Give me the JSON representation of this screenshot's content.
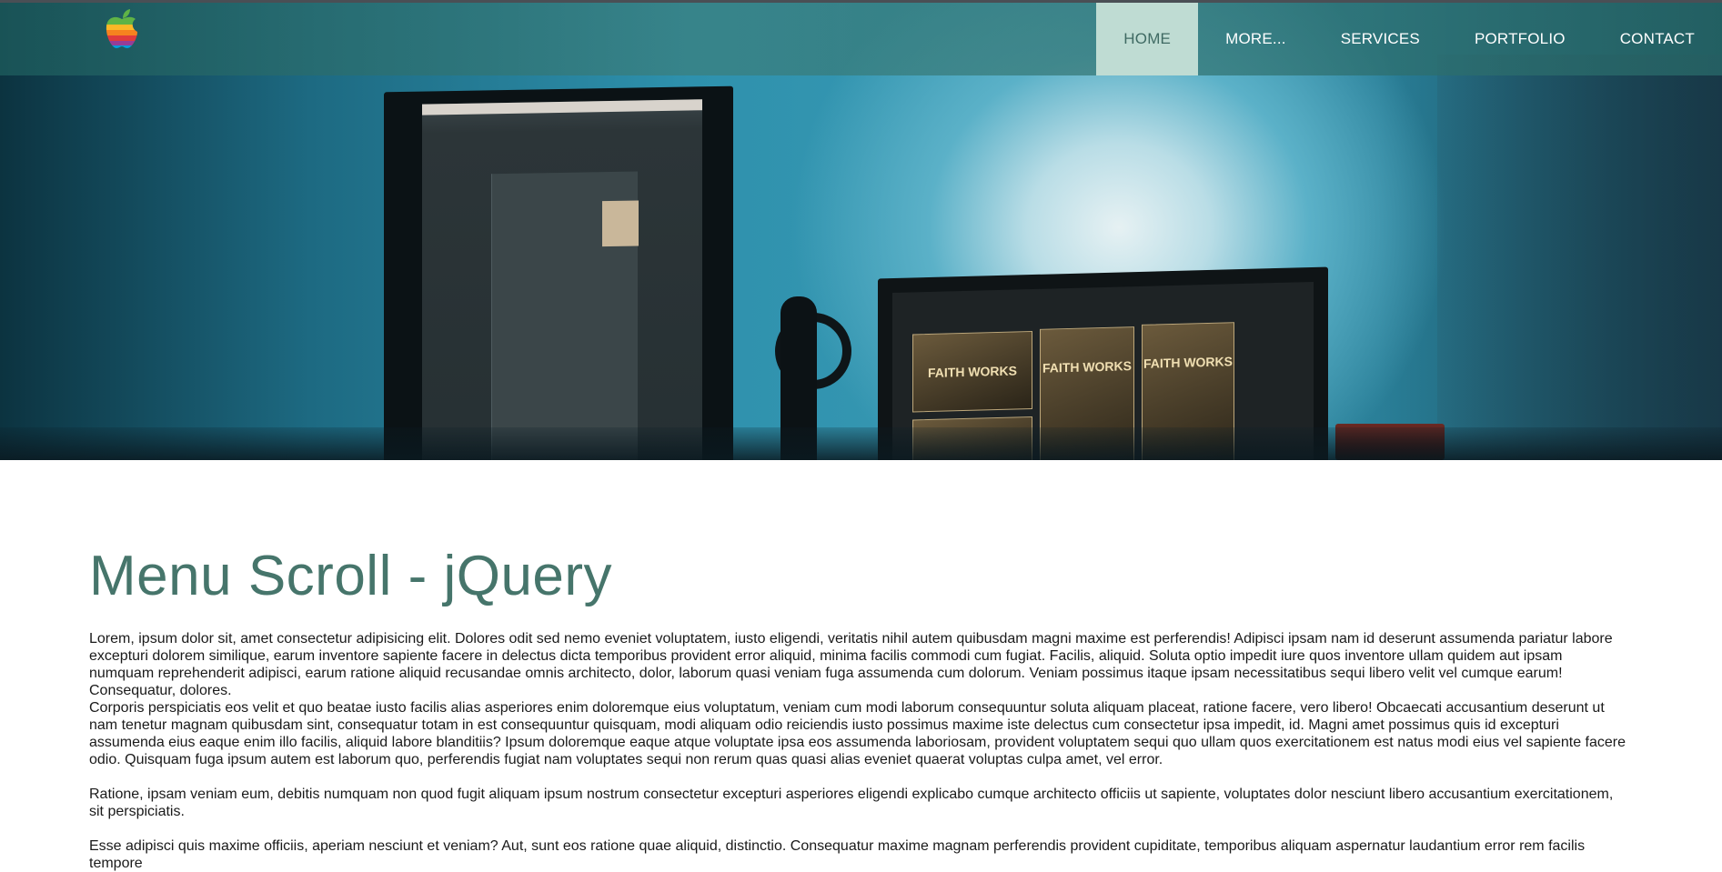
{
  "header": {
    "logo_icon": "apple-rainbow-logo-icon",
    "nav": [
      {
        "label": "HOME",
        "active": true
      },
      {
        "label": "MORE...",
        "active": false
      },
      {
        "label": "SERVICES",
        "active": false
      },
      {
        "label": "PORTFOLIO",
        "active": false
      },
      {
        "label": "CONTACT",
        "active": false
      }
    ]
  },
  "hero": {
    "image": "desk setup with two monitors",
    "screen_tiles": [
      "FAITH WORKS",
      "FAITH WORKS",
      "FAITH WORKS"
    ]
  },
  "main": {
    "title": "Menu Scroll - jQuery",
    "paragraphs": [
      "Lorem, ipsum dolor sit, amet consectetur adipisicing elit. Dolores odit sed nemo eveniet voluptatem, iusto eligendi, veritatis nihil autem quibusdam magni maxime est perferendis! Adipisci ipsam nam id deserunt assumenda pariatur labore excepturi dolorem similique, earum inventore sapiente facere in delectus dicta temporibus provident error aliquid, minima facilis commodi cum fugiat. Facilis, aliquid. Soluta optio impedit iure quos inventore ullam quidem aut ipsam numquam reprehenderit adipisci, earum ratione aliquid recusandae omnis architecto, dolor, laborum quasi veniam fuga assumenda cum dolorum. Veniam possimus itaque ipsam necessitatibus sequi libero velit vel cumque earum! Consequatur, dolores.",
      "Corporis perspiciatis eos velit et quo beatae iusto facilis alias asperiores enim doloremque eius voluptatum, veniam cum modi laborum consequuntur soluta aliquam placeat, ratione facere, vero libero! Obcaecati accusantium deserunt ut nam tenetur magnam quibusdam sint, consequatur totam in est consequuntur quisquam, modi aliquam odio reiciendis iusto possimus maxime iste delectus cum consectetur ipsa impedit, id. Magni amet possimus quis id excepturi assumenda eius eaque enim illo facilis, aliquid labore blanditiis? Ipsum doloremque eaque atque voluptate ipsa eos assumenda laboriosam, provident voluptatem sequi quo ullam quos exercitationem est natus modi eius vel sapiente facere odio. Quisquam fuga ipsum autem est laborum quo, perferendis fugiat nam voluptates sequi non rerum quas quasi alias eveniet quaerat voluptas culpa amet, vel error.",
      "Ratione, ipsam veniam eum, debitis numquam non quod fugit aliquam ipsum nostrum consectetur excepturi asperiores eligendi explicabo cumque architecto officiis ut sapiente, voluptates dolor nesciunt libero accusantium exercitationem, sit perspiciatis.",
      "Esse adipisci quis maxime officiis, aperiam nesciunt et veniam? Aut, sunt eos ratione quae aliquid, distinctio. Consequatur maxime magnam perferendis provident cupiditate, temporibus aliquam aspernatur laudantium error rem facilis tempore"
    ]
  },
  "colors": {
    "nav_active_bg": "#bfdcd3",
    "nav_active_text": "#3f6a63",
    "title": "#46756b",
    "body_text": "#1a1a1a"
  }
}
